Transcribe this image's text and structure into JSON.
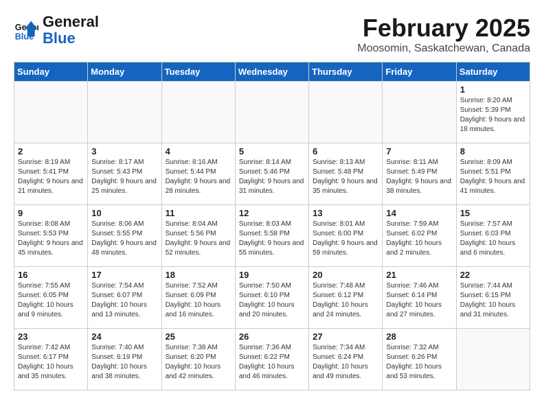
{
  "header": {
    "logo_general": "General",
    "logo_blue": "Blue",
    "month_title": "February 2025",
    "location": "Moosomin, Saskatchewan, Canada"
  },
  "days_of_week": [
    "Sunday",
    "Monday",
    "Tuesday",
    "Wednesday",
    "Thursday",
    "Friday",
    "Saturday"
  ],
  "weeks": [
    [
      {
        "day": "",
        "info": ""
      },
      {
        "day": "",
        "info": ""
      },
      {
        "day": "",
        "info": ""
      },
      {
        "day": "",
        "info": ""
      },
      {
        "day": "",
        "info": ""
      },
      {
        "day": "",
        "info": ""
      },
      {
        "day": "1",
        "info": "Sunrise: 8:20 AM\nSunset: 5:39 PM\nDaylight: 9 hours and 18 minutes."
      }
    ],
    [
      {
        "day": "2",
        "info": "Sunrise: 8:19 AM\nSunset: 5:41 PM\nDaylight: 9 hours and 21 minutes."
      },
      {
        "day": "3",
        "info": "Sunrise: 8:17 AM\nSunset: 5:43 PM\nDaylight: 9 hours and 25 minutes."
      },
      {
        "day": "4",
        "info": "Sunrise: 8:16 AM\nSunset: 5:44 PM\nDaylight: 9 hours and 28 minutes."
      },
      {
        "day": "5",
        "info": "Sunrise: 8:14 AM\nSunset: 5:46 PM\nDaylight: 9 hours and 31 minutes."
      },
      {
        "day": "6",
        "info": "Sunrise: 8:13 AM\nSunset: 5:48 PM\nDaylight: 9 hours and 35 minutes."
      },
      {
        "day": "7",
        "info": "Sunrise: 8:11 AM\nSunset: 5:49 PM\nDaylight: 9 hours and 38 minutes."
      },
      {
        "day": "8",
        "info": "Sunrise: 8:09 AM\nSunset: 5:51 PM\nDaylight: 9 hours and 41 minutes."
      }
    ],
    [
      {
        "day": "9",
        "info": "Sunrise: 8:08 AM\nSunset: 5:53 PM\nDaylight: 9 hours and 45 minutes."
      },
      {
        "day": "10",
        "info": "Sunrise: 8:06 AM\nSunset: 5:55 PM\nDaylight: 9 hours and 48 minutes."
      },
      {
        "day": "11",
        "info": "Sunrise: 8:04 AM\nSunset: 5:56 PM\nDaylight: 9 hours and 52 minutes."
      },
      {
        "day": "12",
        "info": "Sunrise: 8:03 AM\nSunset: 5:58 PM\nDaylight: 9 hours and 55 minutes."
      },
      {
        "day": "13",
        "info": "Sunrise: 8:01 AM\nSunset: 6:00 PM\nDaylight: 9 hours and 59 minutes."
      },
      {
        "day": "14",
        "info": "Sunrise: 7:59 AM\nSunset: 6:02 PM\nDaylight: 10 hours and 2 minutes."
      },
      {
        "day": "15",
        "info": "Sunrise: 7:57 AM\nSunset: 6:03 PM\nDaylight: 10 hours and 6 minutes."
      }
    ],
    [
      {
        "day": "16",
        "info": "Sunrise: 7:55 AM\nSunset: 6:05 PM\nDaylight: 10 hours and 9 minutes."
      },
      {
        "day": "17",
        "info": "Sunrise: 7:54 AM\nSunset: 6:07 PM\nDaylight: 10 hours and 13 minutes."
      },
      {
        "day": "18",
        "info": "Sunrise: 7:52 AM\nSunset: 6:09 PM\nDaylight: 10 hours and 16 minutes."
      },
      {
        "day": "19",
        "info": "Sunrise: 7:50 AM\nSunset: 6:10 PM\nDaylight: 10 hours and 20 minutes."
      },
      {
        "day": "20",
        "info": "Sunrise: 7:48 AM\nSunset: 6:12 PM\nDaylight: 10 hours and 24 minutes."
      },
      {
        "day": "21",
        "info": "Sunrise: 7:46 AM\nSunset: 6:14 PM\nDaylight: 10 hours and 27 minutes."
      },
      {
        "day": "22",
        "info": "Sunrise: 7:44 AM\nSunset: 6:15 PM\nDaylight: 10 hours and 31 minutes."
      }
    ],
    [
      {
        "day": "23",
        "info": "Sunrise: 7:42 AM\nSunset: 6:17 PM\nDaylight: 10 hours and 35 minutes."
      },
      {
        "day": "24",
        "info": "Sunrise: 7:40 AM\nSunset: 6:19 PM\nDaylight: 10 hours and 38 minutes."
      },
      {
        "day": "25",
        "info": "Sunrise: 7:38 AM\nSunset: 6:20 PM\nDaylight: 10 hours and 42 minutes."
      },
      {
        "day": "26",
        "info": "Sunrise: 7:36 AM\nSunset: 6:22 PM\nDaylight: 10 hours and 46 minutes."
      },
      {
        "day": "27",
        "info": "Sunrise: 7:34 AM\nSunset: 6:24 PM\nDaylight: 10 hours and 49 minutes."
      },
      {
        "day": "28",
        "info": "Sunrise: 7:32 AM\nSunset: 6:26 PM\nDaylight: 10 hours and 53 minutes."
      },
      {
        "day": "",
        "info": ""
      }
    ]
  ]
}
